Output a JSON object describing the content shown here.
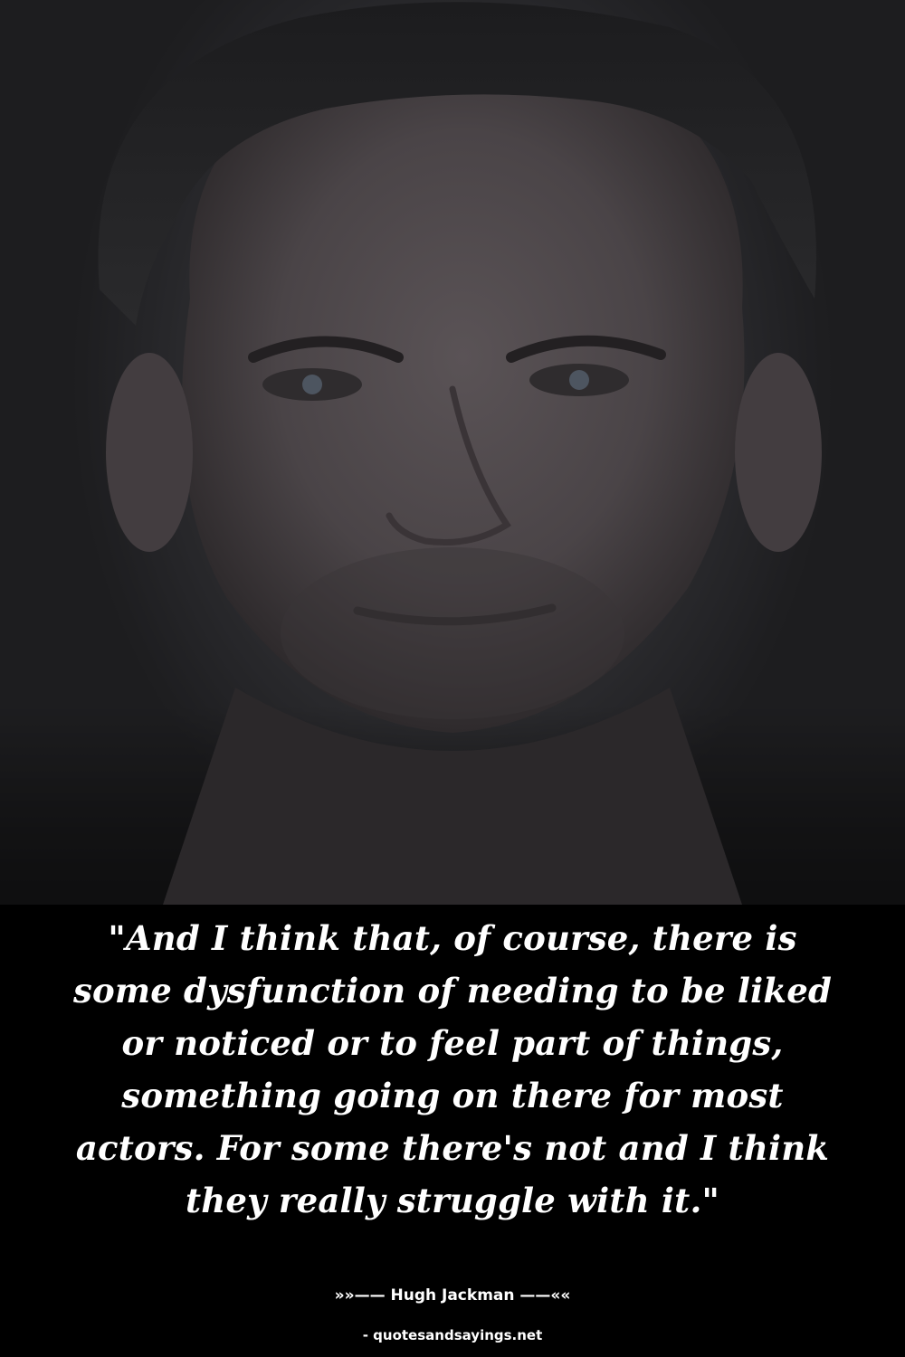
{
  "quote": {
    "text": "\"And I think that, of course, there is some dysfunction of needing to be liked or noticed or to feel part of things, something going on there for most actors. For some there's not and I think they really struggle with it.\""
  },
  "attribution": {
    "text": "»»—— Hugh Jackman ——««"
  },
  "source": {
    "text": "- quotesandsayings.net"
  }
}
